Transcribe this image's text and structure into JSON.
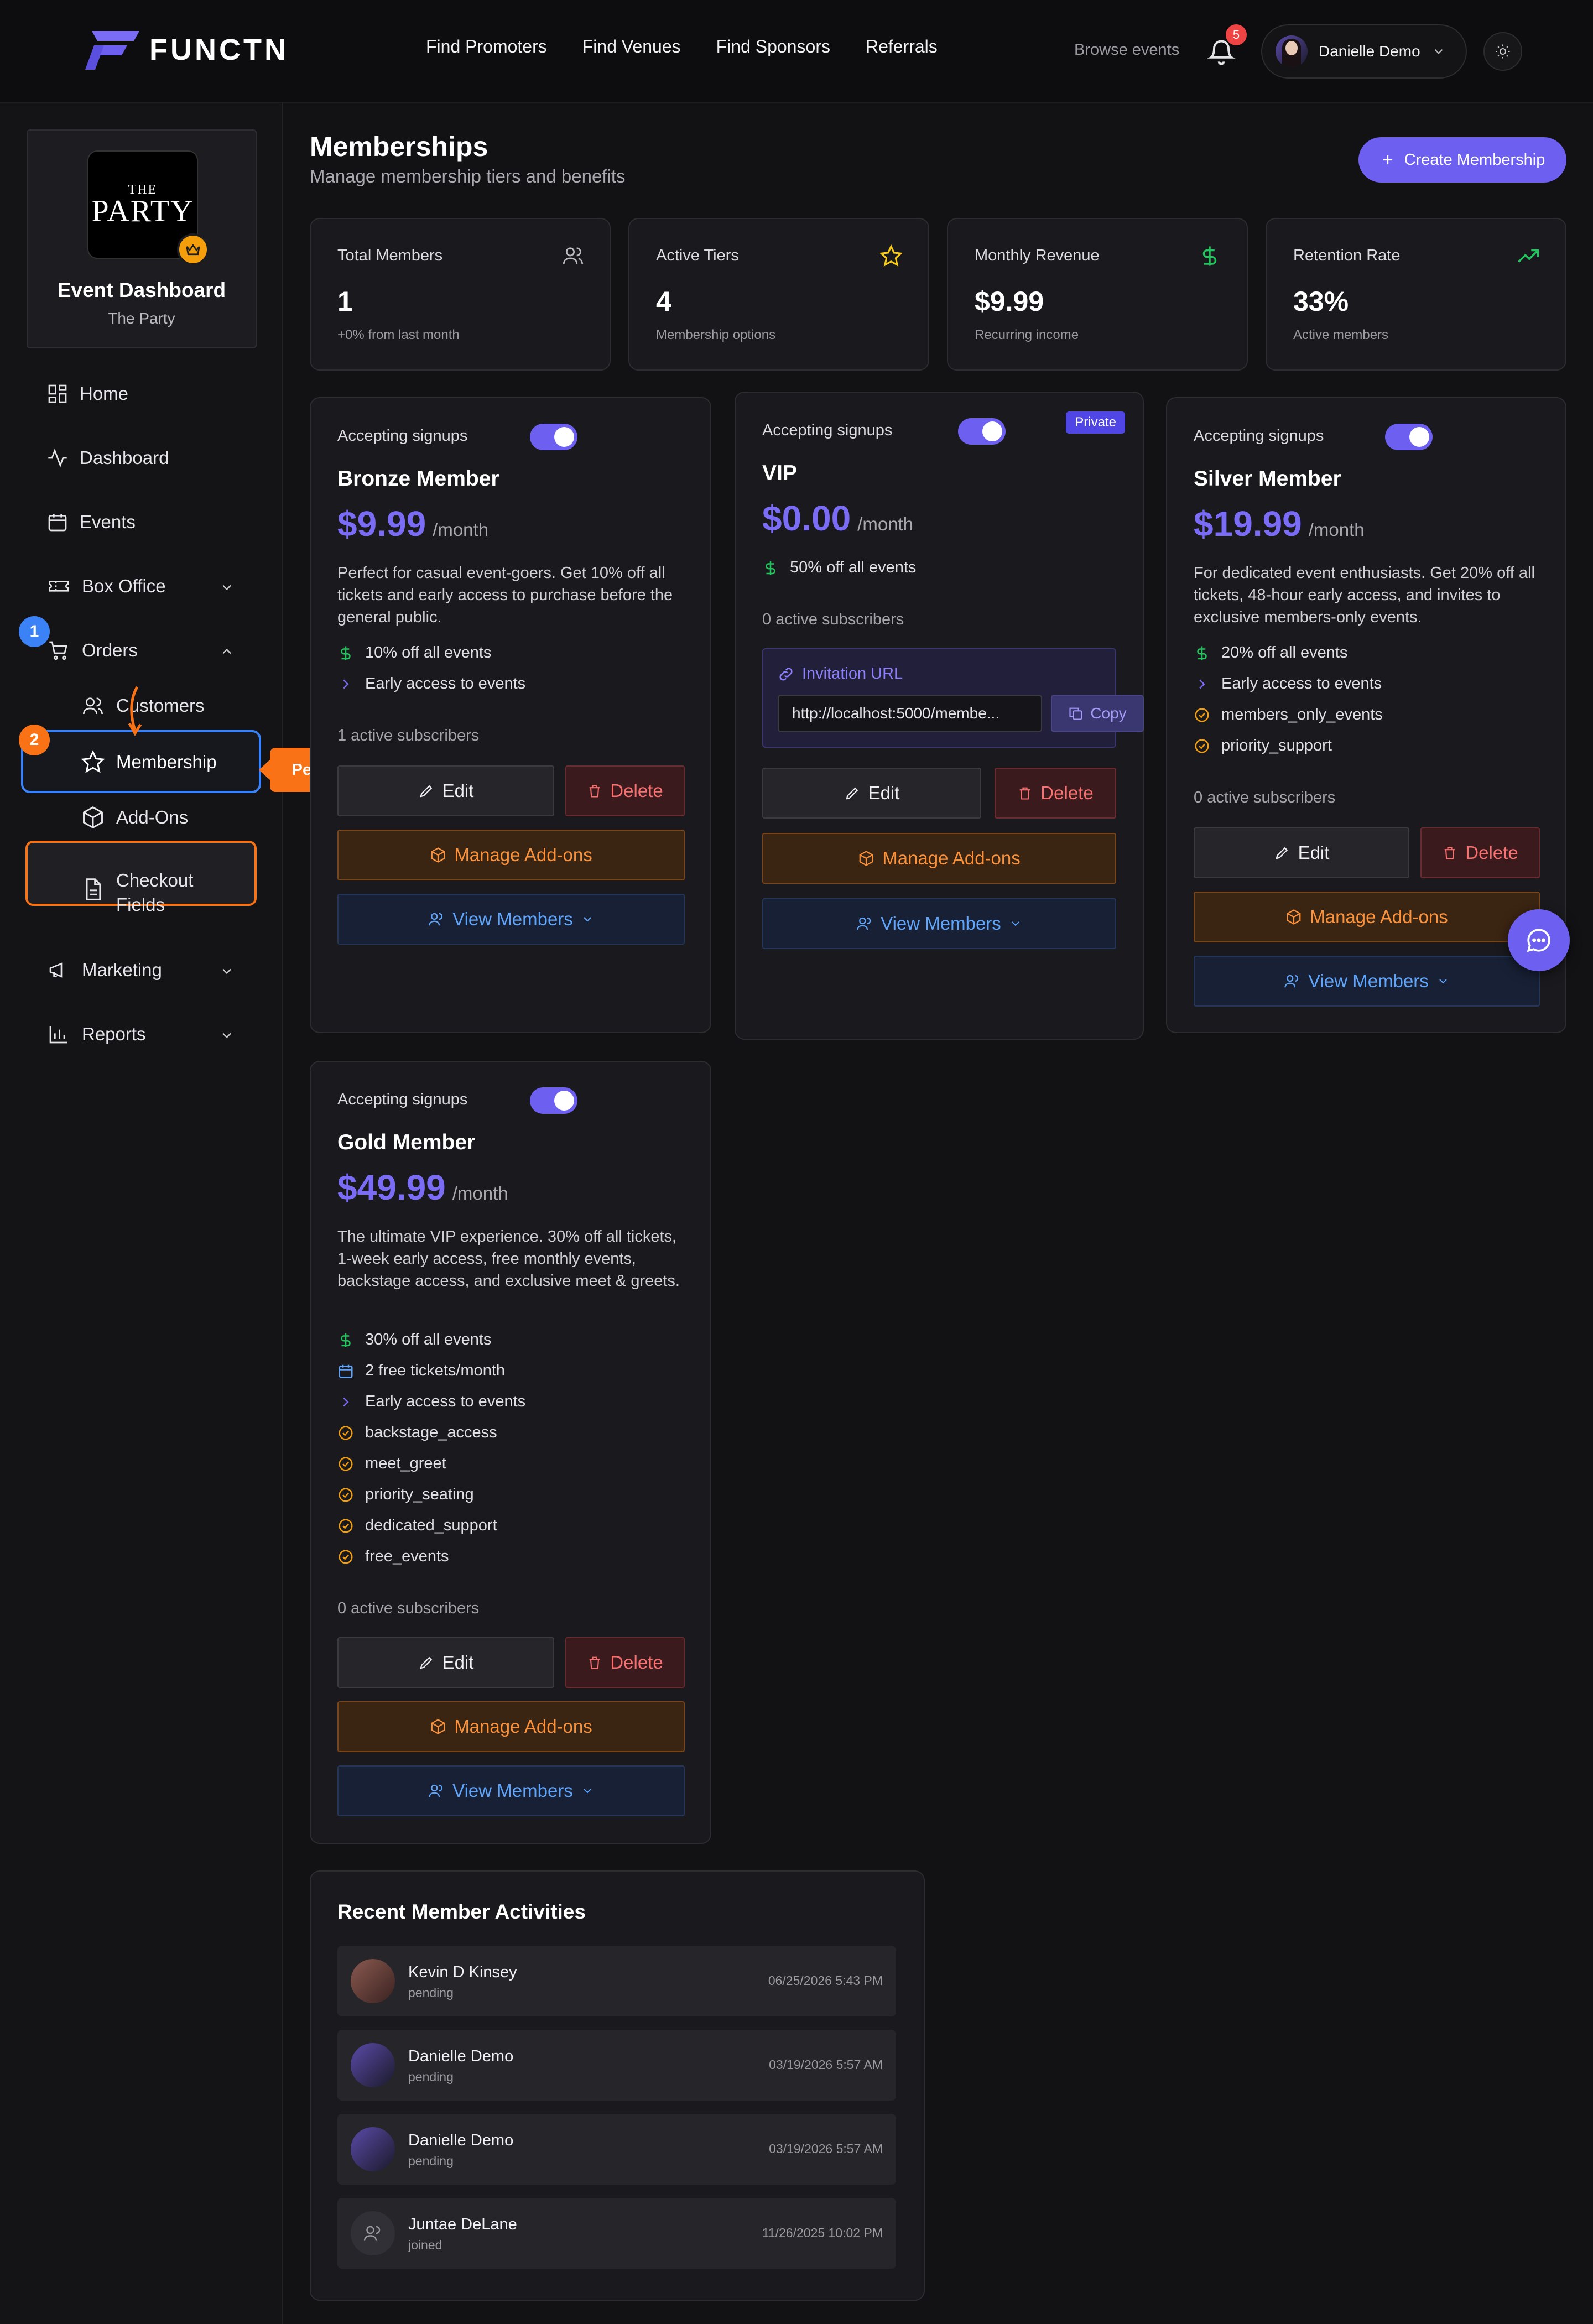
{
  "brand": {
    "name": "FUNCTN",
    "accent": "#6d5ff0"
  },
  "nav": {
    "items": [
      "Find Promoters",
      "Find Venues",
      "Find Sponsors",
      "Referrals"
    ]
  },
  "header": {
    "browse_label": "Browse events",
    "notification_count": "5",
    "user_name": "Danielle Demo"
  },
  "event": {
    "logo_line1": "THE",
    "logo_line2": "PARTY",
    "title": "Event Dashboard",
    "subtitle": "The Party"
  },
  "sidebar": {
    "home": "Home",
    "dashboard": "Dashboard",
    "events": "Events",
    "box_office": "Box Office",
    "orders": "Orders",
    "customers": "Customers",
    "membership": "Membership",
    "addons": "Add-Ons",
    "checkout_fields_1": "Checkout",
    "checkout_fields_2": "Fields",
    "marketing": "Marketing",
    "reports": "Reports"
  },
  "walkthrough": {
    "step1": "1",
    "step2": "2",
    "tooltip": "Perks live on the plan form"
  },
  "page": {
    "title": "Memberships",
    "subtitle": "Manage membership tiers and benefits",
    "create_label": "Create Membership"
  },
  "stats": [
    {
      "label": "Total Members",
      "value": "1",
      "sub": "+0% from last month",
      "icon": "users-icon"
    },
    {
      "label": "Active Tiers",
      "value": "4",
      "sub": "Membership options",
      "icon": "star-icon"
    },
    {
      "label": "Monthly Revenue",
      "value": "$9.99",
      "sub": "Recurring income",
      "icon": "dollar-icon"
    },
    {
      "label": "Retention Rate",
      "value": "33%",
      "sub": "Active members",
      "icon": "trending-up-icon"
    }
  ],
  "common": {
    "accepting": "Accepting signups",
    "per_month": "/month",
    "edit": "Edit",
    "delete": "Delete",
    "manage_addons": "Manage Add-ons",
    "view_members": "View Members"
  },
  "tiers": {
    "bronze": {
      "name": "Bronze Member",
      "price": "$9.99",
      "desc": "Perfect for casual event-goers. Get 10% off all tickets and early access to purchase before the general public.",
      "perks": [
        "10% off all events",
        "Early access to events"
      ],
      "subscribers": "1 active subscribers"
    },
    "vip": {
      "name": "VIP",
      "badge": "Private",
      "price": "$0.00",
      "perks": [
        "50% off all events"
      ],
      "subscribers": "0 active subscribers",
      "invite_label": "Invitation URL",
      "invite_url": "http://localhost:5000/membe...",
      "copy_label": "Copy"
    },
    "silver": {
      "name": "Silver Member",
      "price": "$19.99",
      "desc": "For dedicated event enthusiasts. Get 20% off all tickets, 48-hour early access, and invites to exclusive members-only events.",
      "perks": [
        "20% off all events",
        "Early access to events",
        "members_only_events",
        "priority_support"
      ],
      "subscribers": "0 active subscribers"
    },
    "gold": {
      "name": "Gold Member",
      "price": "$49.99",
      "desc": "The ultimate VIP experience. 30% off all tickets, 1-week early access, free monthly events, backstage access, and exclusive meet & greets.",
      "perks": [
        "30% off all events",
        "2 free tickets/month",
        "Early access to events",
        "backstage_access",
        "meet_greet",
        "priority_seating",
        "dedicated_support",
        "free_events"
      ],
      "subscribers": "0 active subscribers"
    }
  },
  "activity": {
    "title": "Recent Member Activities",
    "rows": [
      {
        "name": "Kevin D Kinsey",
        "status": "pending",
        "time": "06/25/2026 5:43 PM"
      },
      {
        "name": "Danielle Demo",
        "status": "pending",
        "time": "03/19/2026 5:57 AM"
      },
      {
        "name": "Danielle Demo",
        "status": "pending",
        "time": "03/19/2026 5:57 AM"
      },
      {
        "name": "Juntae DeLane",
        "status": "joined",
        "time": "11/26/2025 10:02 PM"
      }
    ]
  }
}
